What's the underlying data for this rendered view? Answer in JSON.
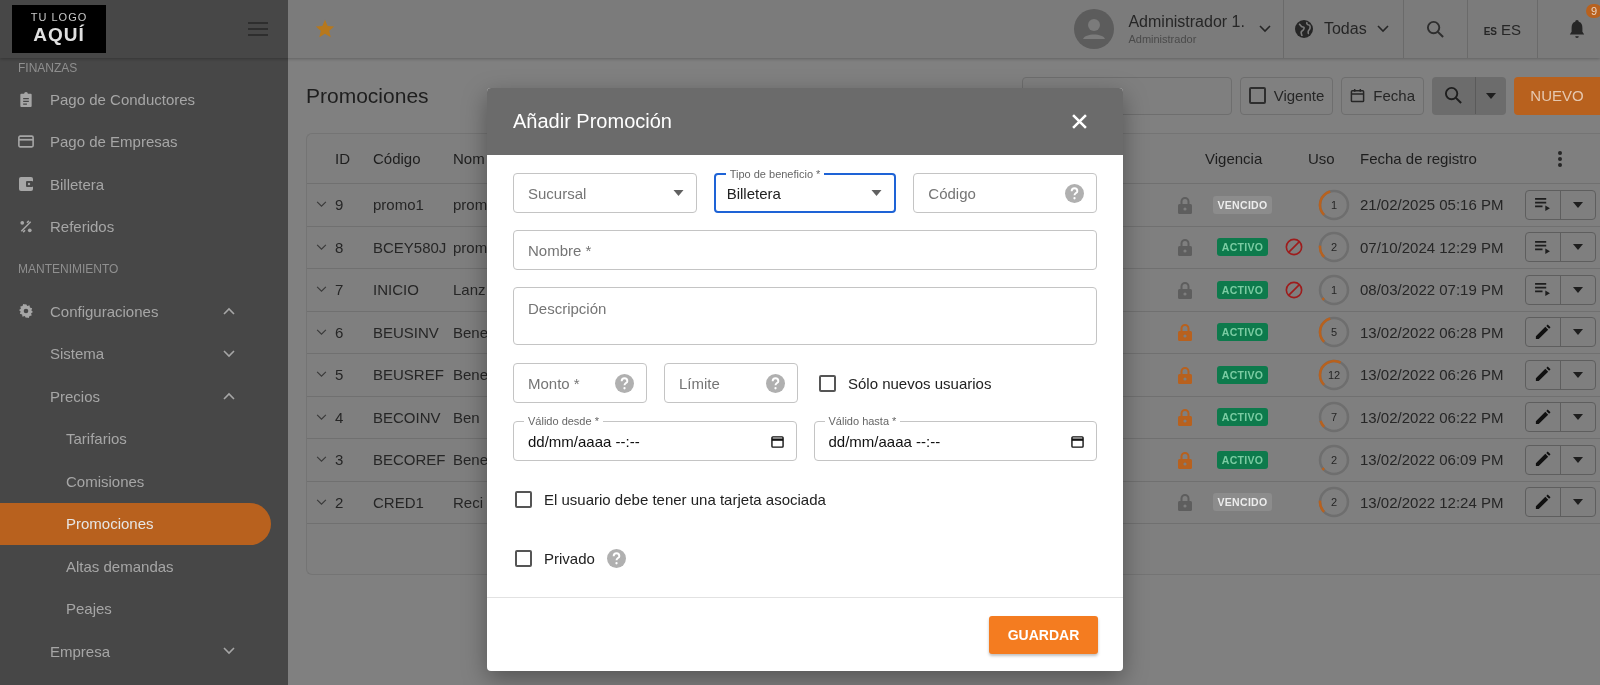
{
  "header": {
    "logo_lines": [
      "TU LOGO",
      "AQUÍ"
    ],
    "user": {
      "name": "Administrador 1.",
      "role": "Administrador"
    },
    "region": "Todas",
    "language": {
      "flag": "ES",
      "label": "ES"
    },
    "notifications": "9"
  },
  "sidebar": {
    "sections": [
      {
        "title": "FINANZAS",
        "items": [
          {
            "label": "Pago de Conductores",
            "selected": false
          },
          {
            "label": "Pago de Empresas",
            "selected": false
          },
          {
            "label": "Billetera",
            "selected": false
          },
          {
            "label": "Referidos",
            "selected": false
          }
        ]
      },
      {
        "title": "MANTENIMIENTO",
        "items": [
          {
            "label": "Configuraciones",
            "selected": false,
            "expanded": true,
            "children": [
              {
                "label": "Sistema",
                "selected": false,
                "expanded": false
              },
              {
                "label": "Precios",
                "selected": false,
                "expanded": true,
                "children": [
                  {
                    "label": "Tarifarios",
                    "selected": false
                  },
                  {
                    "label": "Comisiones",
                    "selected": false
                  },
                  {
                    "label": "Promociones",
                    "selected": true
                  },
                  {
                    "label": "Altas demandas",
                    "selected": false
                  },
                  {
                    "label": "Peajes",
                    "selected": false
                  }
                ]
              }
            ]
          },
          {
            "label": "Empresa",
            "selected": false,
            "expanded": false
          }
        ]
      }
    ]
  },
  "page": {
    "title": "Promociones",
    "toolbar": {
      "vigente": {
        "label": "Vigente",
        "checked": false
      },
      "date_button": "Fecha",
      "new_button": "NUEVO"
    }
  },
  "table": {
    "columns": [
      "ID",
      "Código",
      "Nom",
      "Vigencia",
      "Uso",
      "Fecha de registro"
    ],
    "rows": [
      {
        "expanded": false,
        "id": "9",
        "code": "promo1",
        "name": "prom",
        "lock_active": false,
        "status": {
          "kind": "vencido",
          "label": "VENCIDO"
        },
        "blocked": false,
        "usage": "1",
        "level": 0.33,
        "date": "21/02/2025 05:16 PM",
        "kind": "list"
      },
      {
        "expanded": false,
        "id": "8",
        "code": "BCEY580J",
        "name": "prom",
        "lock_active": false,
        "status": {
          "kind": "activo",
          "label": "ACTIVO"
        },
        "blocked": true,
        "usage": "2",
        "level": 0.14,
        "date": "07/10/2024 12:29 PM",
        "kind": "list"
      },
      {
        "expanded": false,
        "id": "7",
        "code": "INICIO",
        "name": "Lanz",
        "lock_active": false,
        "status": {
          "kind": "activo",
          "label": "ACTIVO"
        },
        "blocked": true,
        "usage": "1",
        "level": 0.03,
        "date": "08/03/2022 07:19 PM",
        "kind": "list"
      },
      {
        "expanded": false,
        "id": "6",
        "code": "BEUSINV",
        "name": "Bene",
        "lock_active": true,
        "status": {
          "kind": "activo",
          "label": "ACTIVO"
        },
        "blocked": false,
        "usage": "5",
        "level": 0.33,
        "date": "13/02/2022 06:28 PM",
        "kind": "edit"
      },
      {
        "expanded": false,
        "id": "5",
        "code": "BEUSREF",
        "name": "Bene",
        "lock_active": true,
        "status": {
          "kind": "activo",
          "label": "ACTIVO"
        },
        "blocked": false,
        "usage": "12",
        "level": 0.45,
        "date": "13/02/2022 06:26 PM",
        "kind": "edit"
      },
      {
        "expanded": false,
        "id": "4",
        "code": "BECOINV",
        "name": "Ben",
        "lock_active": true,
        "status": {
          "kind": "activo",
          "label": "ACTIVO"
        },
        "blocked": false,
        "usage": "7",
        "level": 0.08,
        "date": "13/02/2022 06:22 PM",
        "kind": "edit"
      },
      {
        "expanded": false,
        "id": "3",
        "code": "BECOREF",
        "name": "Bene",
        "lock_active": true,
        "status": {
          "kind": "activo",
          "label": "ACTIVO"
        },
        "blocked": false,
        "usage": "2",
        "level": 0.03,
        "date": "13/02/2022 06:09 PM",
        "kind": "edit"
      },
      {
        "expanded": false,
        "id": "2",
        "code": "CRED1",
        "name": "Reci",
        "lock_active": false,
        "status": {
          "kind": "vencido",
          "label": "VENCIDO"
        },
        "blocked": false,
        "usage": "2",
        "level": 0.14,
        "date": "13/02/2022 12:24 PM",
        "kind": "edit"
      }
    ]
  },
  "modal": {
    "title": "Añadir Promoción",
    "rows": [
      [
        {
          "kind": "select",
          "placeholder": "Sucursal",
          "focused": false
        },
        {
          "kind": "select",
          "label": "Tipo de beneficio *",
          "value": "Billetera",
          "focused": true
        },
        {
          "kind": "text",
          "placeholder": "Código",
          "help": true,
          "focused": false
        }
      ],
      [
        {
          "kind": "text",
          "placeholder": "Nombre *",
          "focused": false
        }
      ],
      [
        {
          "kind": "textarea",
          "placeholder": "Descripción",
          "focused": false
        }
      ],
      [
        {
          "kind": "text",
          "placeholder": "Monto *",
          "help": true,
          "focused": false
        },
        {
          "kind": "text",
          "placeholder": "Límite",
          "help": true,
          "focused": false
        },
        {
          "kind": "checkbox",
          "label": "Sólo nuevos usuarios",
          "checked": false
        }
      ],
      [
        {
          "kind": "date",
          "label": "Válido desde *",
          "placeholder": "dd/mm/aaaa --:--",
          "focused": false
        },
        {
          "kind": "date",
          "label": "Válido hasta *",
          "placeholder": "dd/mm/aaaa --:--",
          "focused": false
        }
      ],
      [
        {
          "kind": "checkbox",
          "label": "El usuario debe tener una tarjeta asociada",
          "checked": false
        }
      ],
      [
        {
          "kind": "checkbox",
          "label": "Privado",
          "checked": false,
          "help": true
        }
      ]
    ],
    "save_button": "GUARDAR"
  }
}
